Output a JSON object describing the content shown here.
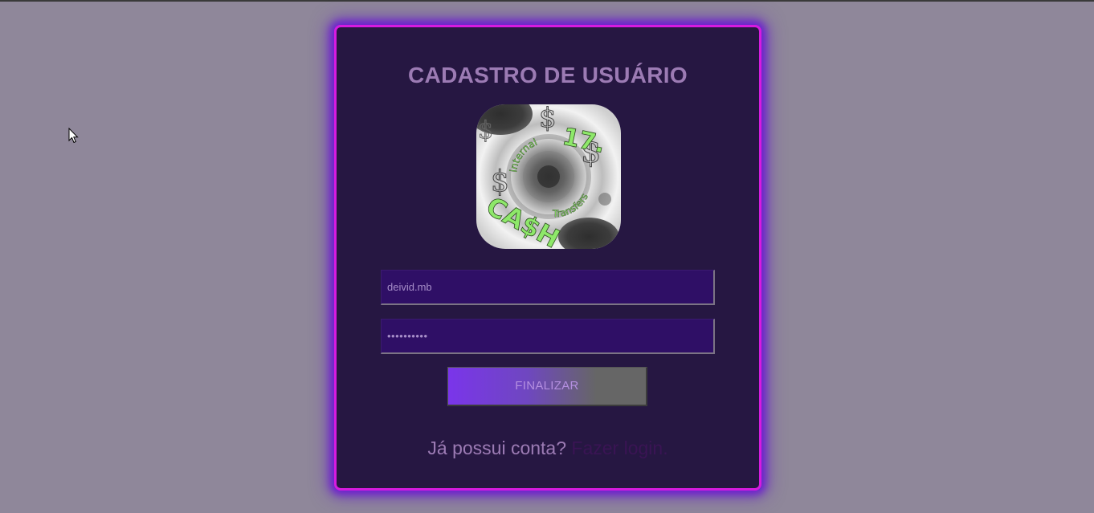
{
  "form": {
    "title": "CADASTRO DE USUÁRIO",
    "username_value": "deivid.mb",
    "password_value": "••••••••••",
    "submit_label": "FINALIZAR",
    "footer_prompt": "Já possui conta?",
    "login_link": "Fazer login."
  },
  "logo": {
    "top_text": "17.",
    "left_text": "CA$H",
    "arc_text_1": "internal",
    "arc_text_2": "Transfers",
    "icon": "cash-transfer-logo"
  },
  "colors": {
    "background": "#8f879a",
    "card": "#261742",
    "card_border": "#d61bdf",
    "title": "#9c7bb4",
    "input_bg": "#2f0f66",
    "link": "#3a1454",
    "logo_text": "#8ee86a"
  }
}
